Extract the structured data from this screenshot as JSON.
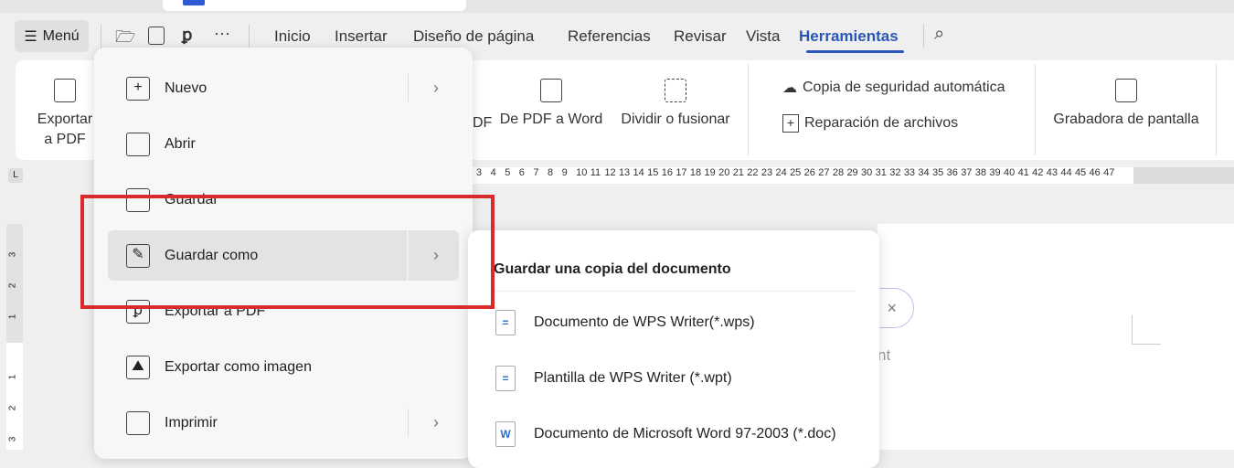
{
  "menu_button": {
    "label": "Menú",
    "icon": "hamburger-icon"
  },
  "nav_tabs": [
    {
      "label": "Inicio"
    },
    {
      "label": "Insertar"
    },
    {
      "label": "Diseño de página"
    },
    {
      "label": "Referencias"
    },
    {
      "label": "Revisar"
    },
    {
      "label": "Vista"
    },
    {
      "label": "Herramientas",
      "active": true
    }
  ],
  "ribbon": {
    "export_pdf": "Exportar",
    "export_pdf2": "a PDF",
    "partial_pdf": "DF",
    "pdf_to_word": "De PDF a Word",
    "split_merge": "Dividir o fusionar",
    "auto_backup": "Copia de seguridad automática",
    "file_repair": "Reparación de archivos",
    "screen_recorder": "Grabadora de pantalla"
  },
  "ruler": {
    "numbers": [
      "3",
      "4",
      "5",
      "6",
      "7",
      "8",
      "9",
      "10",
      "11",
      "12",
      "13",
      "14",
      "15",
      "16",
      "17",
      "18",
      "19",
      "20",
      "21",
      "22",
      "23",
      "24",
      "25",
      "26",
      "27",
      "28",
      "29",
      "30",
      "31",
      "32",
      "33",
      "34",
      "35",
      "36",
      "37",
      "38",
      "39",
      "40",
      "41",
      "42",
      "43",
      "44",
      "45",
      "46",
      "47"
    ],
    "vertical": [
      "3",
      "2",
      "1",
      "1",
      "2",
      "3"
    ],
    "corner": "L"
  },
  "file_menu": {
    "items": [
      {
        "label": "Nuevo"
      },
      {
        "label": "Abrir"
      },
      {
        "label": "Guardar"
      },
      {
        "label": "Guardar como"
      },
      {
        "label": "Exportar a PDF"
      },
      {
        "label": "Exportar como imagen"
      },
      {
        "label": "Imprimir"
      }
    ]
  },
  "save_as_submenu": {
    "title": "Guardar una copia del documento",
    "items": [
      {
        "label": "Documento de WPS Writer(*.wps)"
      },
      {
        "label": "Plantilla de WPS Writer (*.wpt)"
      },
      {
        "label": "Documento de Microsoft Word 97-2003 (*.doc)"
      }
    ]
  },
  "background": {
    "partial_text": "nt",
    "close": "×"
  },
  "colors": {
    "accent": "#2a56b8",
    "highlight": "#d92b2b"
  }
}
